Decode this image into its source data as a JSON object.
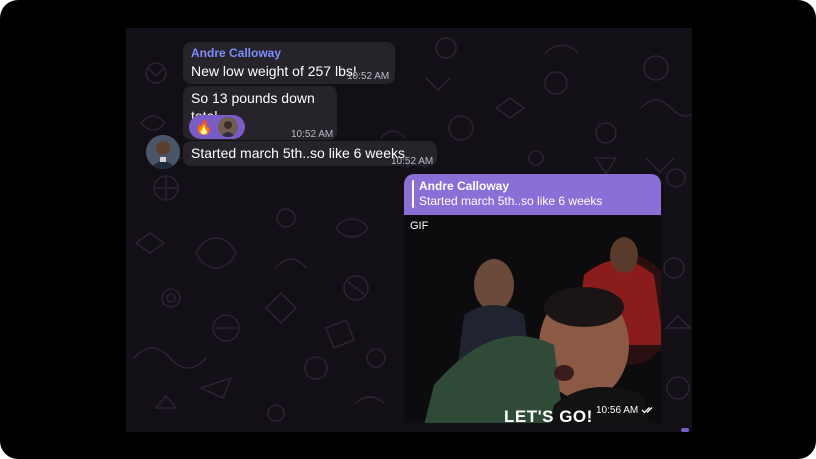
{
  "messages": [
    {
      "sender": "Andre Calloway",
      "text": "New low weight of 257 lbs!",
      "time": "10:52 AM"
    },
    {
      "text": "So 13 pounds down total",
      "time": "10:52 AM",
      "reactions": {
        "emoji": "🔥",
        "icon": "reactor-avatar"
      }
    },
    {
      "text": "Started march 5th..so like 6 weeks",
      "time": "10:52 AM",
      "avatar": "sender-avatar"
    }
  ],
  "reply": {
    "quoted_sender": "Andre Calloway",
    "quoted_text": "Started march 5th..so like 6 weeks",
    "media_label": "GIF",
    "gif_caption": "LET'S GO!",
    "time": "10:56 AM",
    "status_icon": "double-check-icon",
    "accent": "#8a6fd7"
  },
  "theme": {
    "background": "#120f16",
    "incoming_bubble": "#26232b",
    "sender_color": "#7f8dff",
    "reaction_bg": "#7a5cc7"
  }
}
